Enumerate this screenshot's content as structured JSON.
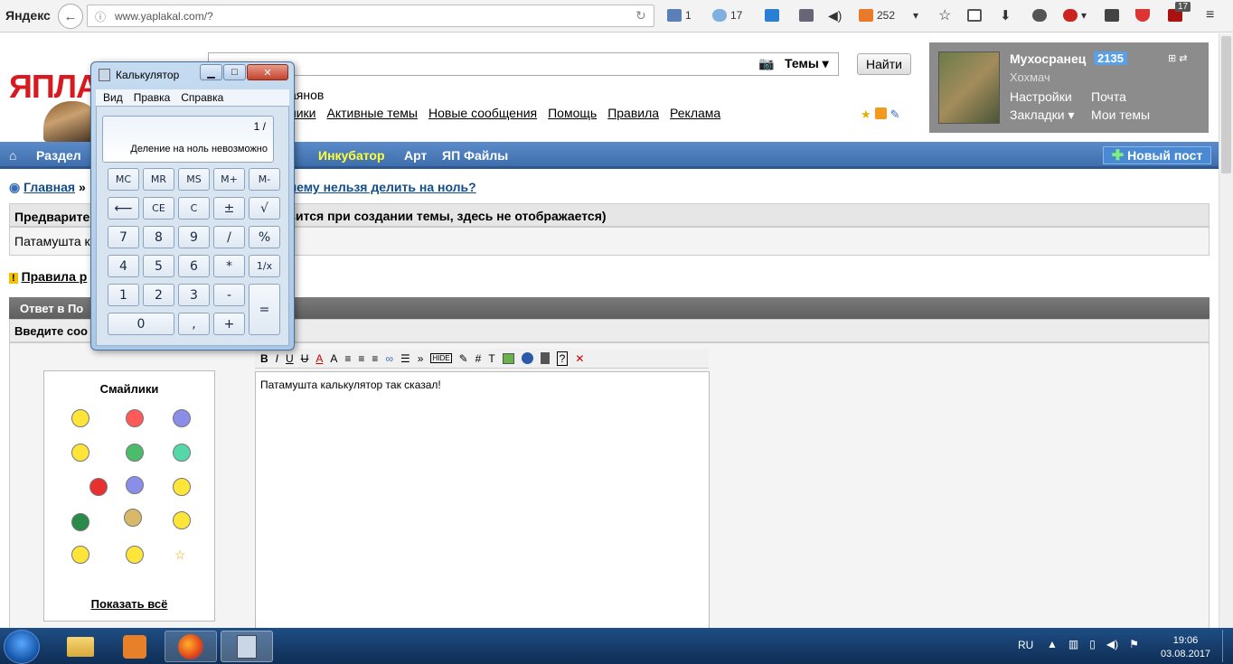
{
  "browser": {
    "brand": "Яндекс",
    "url": "www.yaplakal.com/?",
    "mail_count": "1",
    "weather": "17",
    "counter": "252",
    "ext_badge": "17"
  },
  "site": {
    "logo_text": "ЯПЛА",
    "search_scope": "Темы",
    "find_button": "Найти",
    "tagline": "аянов",
    "top_links": [
      "ники",
      "Активные темы",
      "Новые сообщения",
      "Помощь",
      "Правила",
      "Реклама"
    ]
  },
  "user": {
    "name": "Мухосранец",
    "karma": "2135",
    "status": "Хохмач",
    "links": [
      "Настройки",
      "Почта",
      "Закладки ▾",
      "Мои темы"
    ]
  },
  "nav": {
    "home_icon": "home-icon",
    "items": [
      "Раздел",
      "Инкубатор",
      "Арт",
      "ЯП Файлы"
    ],
    "new_post": "Новый пост"
  },
  "breadcrumb": {
    "home": "Главная",
    "sep": "»",
    "topic": "чему нельзя делить на ноль?"
  },
  "preview": {
    "head_left": "Предварите",
    "head_right": "зится при создании темы, здесь не отображается)",
    "body": "Патамушта к"
  },
  "rules": {
    "label": "Правила р"
  },
  "reply": {
    "head": "Ответ в По",
    "subhead": "Введите соо"
  },
  "smilies": {
    "title": "Смайлики",
    "show_all": "Показать всё"
  },
  "editor": {
    "content": "Патамушта калькулятор так сказал!"
  },
  "calculator": {
    "title": "Калькулятор",
    "menu": [
      "Вид",
      "Правка",
      "Справка"
    ],
    "expression": "1 /",
    "message": "Деление на ноль невозможно",
    "rows": [
      [
        "MC",
        "MR",
        "MS",
        "M+",
        "M-"
      ],
      [
        "⟵",
        "CE",
        "C",
        "±",
        "√"
      ],
      [
        "7",
        "8",
        "9",
        "/",
        "%"
      ],
      [
        "4",
        "5",
        "6",
        "*",
        "1/x"
      ],
      [
        "1",
        "2",
        "3",
        "-",
        "="
      ],
      [
        "0",
        ",",
        "+"
      ]
    ]
  },
  "taskbar": {
    "lang": "RU",
    "time": "19:06",
    "date": "03.08.2017"
  }
}
